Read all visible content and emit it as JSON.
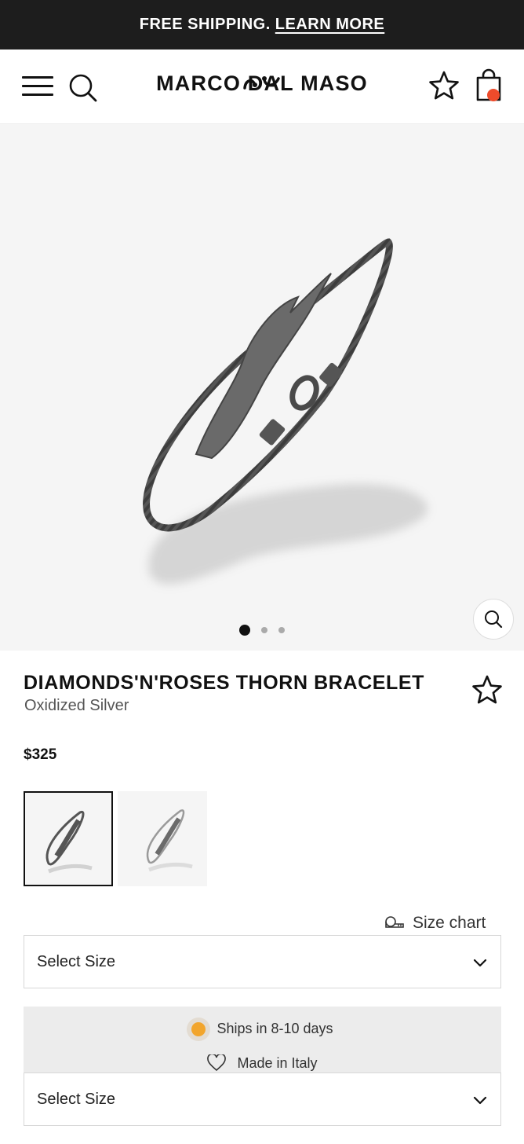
{
  "announcement": {
    "text": "FREE SHIPPING.",
    "link": "LEARN MORE"
  },
  "header": {
    "logo": "MARCO DAL MASO",
    "icons": [
      "menu-icon",
      "search-icon",
      "star-icon",
      "bag-icon"
    ],
    "cart_badge_color": "#ee4b2b"
  },
  "gallery": {
    "slides": 3,
    "active_slide": 1,
    "zoom_icon": "zoom-icon"
  },
  "product": {
    "title": "DIAMONDS'N'ROSES THORN BRACELET",
    "material": "Oxidized Silver",
    "price": "$325"
  },
  "variants": {
    "selected_index": 0,
    "count": 2
  },
  "size_chart": {
    "label": "Size chart"
  },
  "selects": {
    "size_primary": "Select Size",
    "size_secondary": "Select Size"
  },
  "info": {
    "shipping": "Ships in 8-10 days",
    "origin": "Made in Italy",
    "shipping_color": "#f2a52c"
  }
}
